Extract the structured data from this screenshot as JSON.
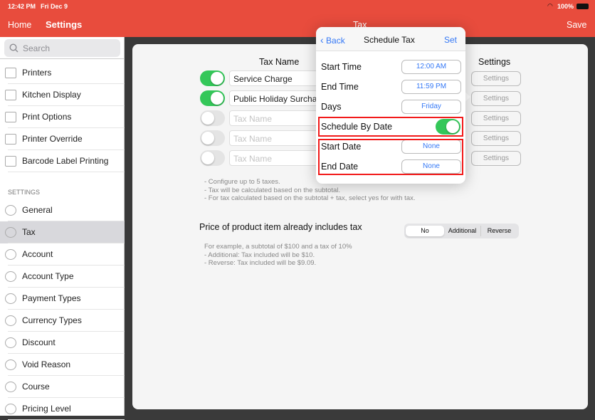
{
  "status": {
    "time": "12:42 PM",
    "date": "Fri Dec 9",
    "battery": "100%"
  },
  "nav": {
    "home": "Home",
    "settings": "Settings",
    "title": "Tax",
    "save": "Save"
  },
  "sidebar": {
    "search_placeholder": "Search",
    "items_top": [
      {
        "label": "Printers",
        "icon": "printer-icon"
      },
      {
        "label": "Kitchen Display",
        "icon": "kitchen-display-icon"
      },
      {
        "label": "Print Options",
        "icon": "print-options-icon"
      },
      {
        "label": "Printer Override",
        "icon": "document-icon"
      },
      {
        "label": "Barcode Label Printing",
        "icon": "barcode-icon"
      }
    ],
    "section": "SETTINGS",
    "items": [
      {
        "label": "General"
      },
      {
        "label": "Tax",
        "selected": true
      },
      {
        "label": "Account"
      },
      {
        "label": "Account Type"
      },
      {
        "label": "Payment Types"
      },
      {
        "label": "Currency Types"
      },
      {
        "label": "Discount"
      },
      {
        "label": "Void Reason"
      },
      {
        "label": "Course"
      },
      {
        "label": "Pricing Level"
      }
    ]
  },
  "main": {
    "tax_name_header": "Tax Name",
    "settings_header": "Settings",
    "rows": [
      {
        "on": true,
        "value": "Service Charge",
        "placeholder": "Tax Name"
      },
      {
        "on": true,
        "value": "Public Holiday Surcharge",
        "placeholder": "Tax Name"
      },
      {
        "on": false,
        "value": "",
        "placeholder": "Tax Name"
      },
      {
        "on": false,
        "value": "",
        "placeholder": "Tax Name"
      },
      {
        "on": false,
        "value": "",
        "placeholder": "Tax Name"
      }
    ],
    "settings_button": "Settings",
    "notes": [
      "- Configure up to 5 taxes.",
      "- Tax will be calculated based on the subtotal.",
      "- For tax calculated based on the subtotal + tax, select yes for with tax."
    ],
    "includes_label": "Price of product item already includes tax",
    "segments": [
      "No",
      "Additional",
      "Reverse"
    ],
    "segment_selected": "No",
    "example": [
      "For example, a subtotal of $100 and a tax of 10%",
      "- Additional: Tax included will be $10.",
      "- Reverse: Tax included will be $9.09."
    ]
  },
  "popover": {
    "back": "Back",
    "title": "Schedule Tax",
    "set": "Set",
    "rows": [
      {
        "label": "Start Time",
        "value": "12:00 AM"
      },
      {
        "label": "End Time",
        "value": "11:59 PM"
      },
      {
        "label": "Days",
        "value": "Friday"
      }
    ],
    "schedule_by_date": "Schedule By Date",
    "schedule_by_date_on": true,
    "start_date": {
      "label": "Start Date",
      "value": "None"
    },
    "end_date": {
      "label": "End Date",
      "value": "None"
    }
  },
  "colors": {
    "accent": "#e84c3d",
    "link": "#3478f6",
    "toggle_on": "#34c759",
    "highlight": "#f21a1a"
  }
}
